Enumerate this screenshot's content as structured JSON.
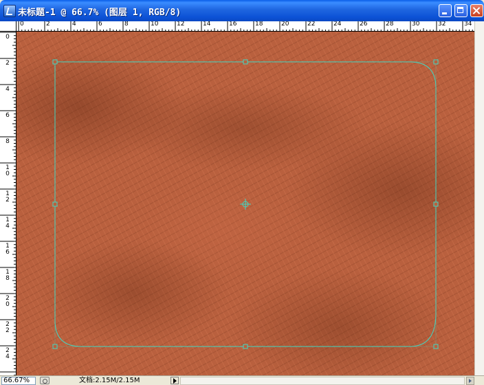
{
  "window": {
    "title": "未标题-1 @ 66.7% (图层 1, RGB/8)",
    "icons": {
      "app": "photoshop-document-icon",
      "minimize": "minimize-icon",
      "maximize": "maximize-icon",
      "close": "close-icon"
    }
  },
  "rulers": {
    "horizontal": [
      "0",
      "2",
      "4",
      "6",
      "8",
      "10",
      "12",
      "14",
      "16",
      "18",
      "20",
      "22",
      "24",
      "26",
      "28",
      "30",
      "32",
      "34"
    ],
    "vertical": [
      "0",
      "2",
      "4",
      "6",
      "8",
      "10",
      "12",
      "14",
      "16",
      "18",
      "20",
      "22",
      "24"
    ]
  },
  "status": {
    "zoom": "66.67%",
    "doc_info": "文档:2.15M/2.15M"
  },
  "colors": {
    "title_bar": "#1f66e0",
    "canvas_base": "#b9603e",
    "path_stroke": "#3fd9c4"
  }
}
